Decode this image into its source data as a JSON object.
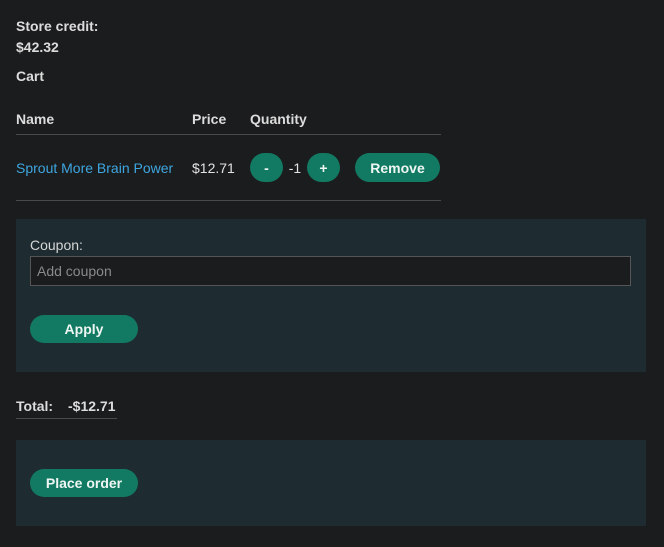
{
  "store_credit": {
    "label": "Store credit:",
    "value": "$42.32"
  },
  "cart": {
    "title": "Cart",
    "columns": [
      "Name",
      "Price",
      "Quantity"
    ],
    "items": [
      {
        "name": "Sprout More Brain Power",
        "price": "$12.71",
        "quantity": "-1",
        "decrement_label": "-",
        "increment_label": "+",
        "remove_label": "Remove"
      }
    ]
  },
  "coupon": {
    "label": "Coupon:",
    "value": "",
    "placeholder": "Add coupon",
    "apply_label": "Apply"
  },
  "total": {
    "label": "Total:",
    "value": "-$12.71"
  },
  "order": {
    "place_order_label": "Place order"
  },
  "colors": {
    "accent": "#127a62",
    "link": "#3ea6e0",
    "panel": "#1e2c31",
    "background": "#1b1c1d"
  }
}
